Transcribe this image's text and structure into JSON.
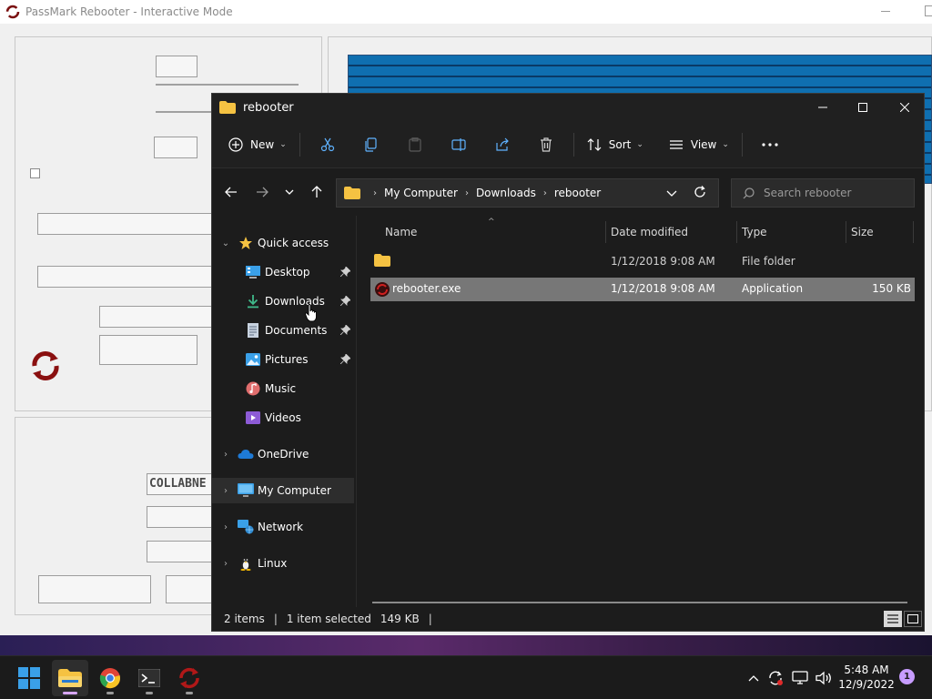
{
  "background_app": {
    "title": "PassMark Rebooter - Interactive Mode",
    "field_text": "COLLABNE"
  },
  "explorer": {
    "title": "rebooter",
    "toolbar": {
      "new_label": "New",
      "sort_label": "Sort",
      "view_label": "View"
    },
    "address": {
      "crumbs": [
        "My Computer",
        "Downloads",
        "rebooter"
      ],
      "search_placeholder": "Search rebooter"
    },
    "nav": {
      "quick_access": "Quick access",
      "items": [
        {
          "label": "Desktop",
          "icon": "desktop-icon",
          "pinned": true
        },
        {
          "label": "Downloads",
          "icon": "download-icon",
          "pinned": true
        },
        {
          "label": "Documents",
          "icon": "document-icon",
          "pinned": true
        },
        {
          "label": "Pictures",
          "icon": "pictures-icon",
          "pinned": true
        },
        {
          "label": "Music",
          "icon": "music-icon",
          "pinned": false
        },
        {
          "label": "Videos",
          "icon": "videos-icon",
          "pinned": false
        }
      ],
      "roots": [
        {
          "label": "OneDrive",
          "icon": "cloud-icon"
        },
        {
          "label": "My Computer",
          "icon": "computer-icon",
          "selected": true
        },
        {
          "label": "Network",
          "icon": "network-icon"
        },
        {
          "label": "Linux",
          "icon": "linux-penguin-icon"
        }
      ]
    },
    "columns": {
      "name": "Name",
      "date": "Date modified",
      "type": "Type",
      "size": "Size"
    },
    "files": [
      {
        "name": "",
        "date": "1/12/2018 9:08 AM",
        "type": "File folder",
        "size": "",
        "icon": "folder-icon",
        "selected": false
      },
      {
        "name": "rebooter.exe",
        "date": "1/12/2018 9:08 AM",
        "type": "Application",
        "size": "150 KB",
        "icon": "rebooter-app-icon",
        "selected": true
      }
    ],
    "status": {
      "items": "2 items",
      "selected": "1 item selected",
      "size": "149 KB"
    }
  },
  "taskbar": {
    "time": "5:48 AM",
    "date": "12/9/2022",
    "notification_count": "1"
  },
  "colors": {
    "explorer_bg": "#1c1c1c",
    "selection": "#777777",
    "accent_folder": "#f5c242",
    "notif_badge": "#c79cff"
  }
}
